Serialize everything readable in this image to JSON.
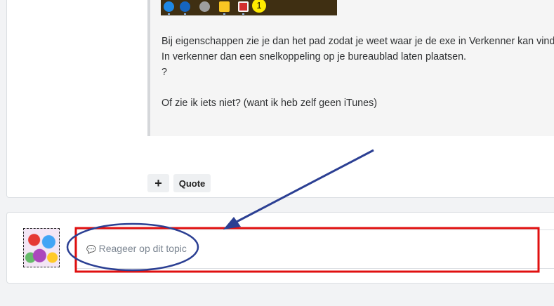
{
  "post": {
    "quote_lines": [
      "Bij eigenschappen zie je dan het pad zodat je weet waar je de exe in Verkenner kan vinden",
      "In verkenner dan een snelkoppeling op je bureaublad laten plaatsen.",
      "?",
      "Of zie ik iets niet?  (want ik heb zelf geen iTunes)"
    ],
    "taskbar_badge": "1",
    "plus_icon": "+",
    "quote_label": "Quote"
  },
  "reply": {
    "icon": "💬",
    "placeholder": "Reageer op dit topic"
  },
  "annotations": {
    "box_color": "#e01010",
    "ellipse_color": "#2b3f93",
    "arrow_color": "#2b3f93"
  }
}
